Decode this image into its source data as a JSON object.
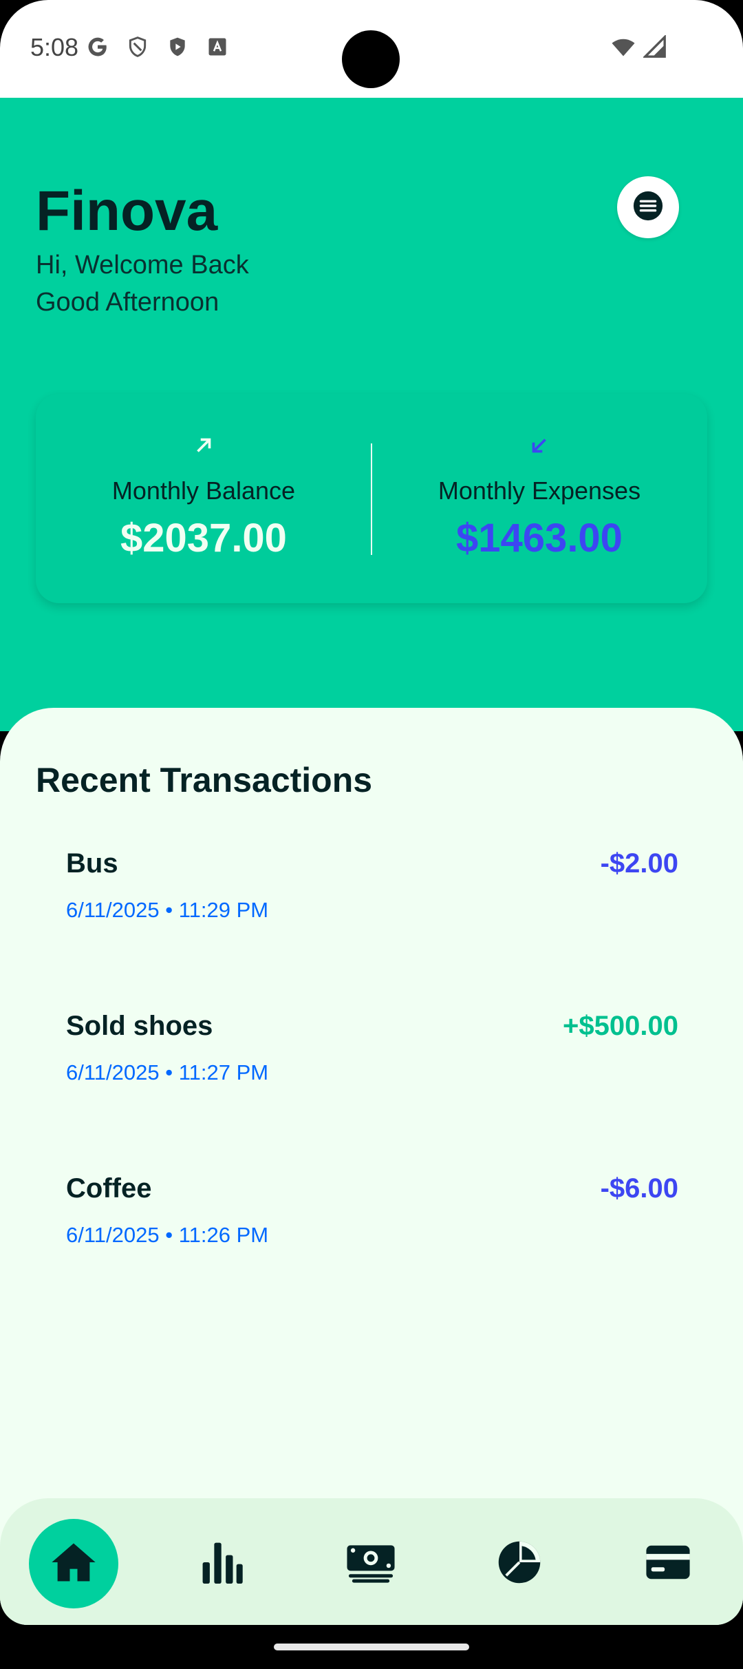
{
  "status_bar": {
    "time": "5:08",
    "left_icons": [
      "google-icon",
      "vpn-shield-icon",
      "play-protect-icon",
      "font-icon"
    ],
    "right_icons": [
      "wifi-icon",
      "signal-icon"
    ]
  },
  "header": {
    "app_title": "Finova",
    "greeting": "Hi, Welcome Back",
    "subgreeting": "Good Afternoon",
    "menu_icon": "menu-icon"
  },
  "summary": {
    "balance_label": "Monthly Balance",
    "balance_value": "$2037.00",
    "expenses_label": "Monthly Expenses",
    "expenses_value": "$1463.00"
  },
  "recent": {
    "title": "Recent Transactions",
    "items": [
      {
        "name": "Bus",
        "datetime": "6/11/2025 • 11:29 PM",
        "amount": "-$2.00"
      },
      {
        "name": "Sold shoes",
        "datetime": "6/11/2025 • 11:27 PM",
        "amount": "+$500.00"
      },
      {
        "name": "Coffee",
        "datetime": "6/11/2025 • 11:26 PM",
        "amount": "-$6.00"
      }
    ]
  },
  "nav": {
    "items": [
      "home-icon",
      "analytics-icon",
      "transactions-icon",
      "categories-icon",
      "cards-icon"
    ],
    "active": "home-icon"
  },
  "colors": {
    "primary": "#00D09E",
    "background": "#F1FFF3",
    "dark_text": "#052224",
    "expense_blue": "#3D46F2",
    "date_blue": "#0068FF",
    "income_green": "#00C08F"
  }
}
